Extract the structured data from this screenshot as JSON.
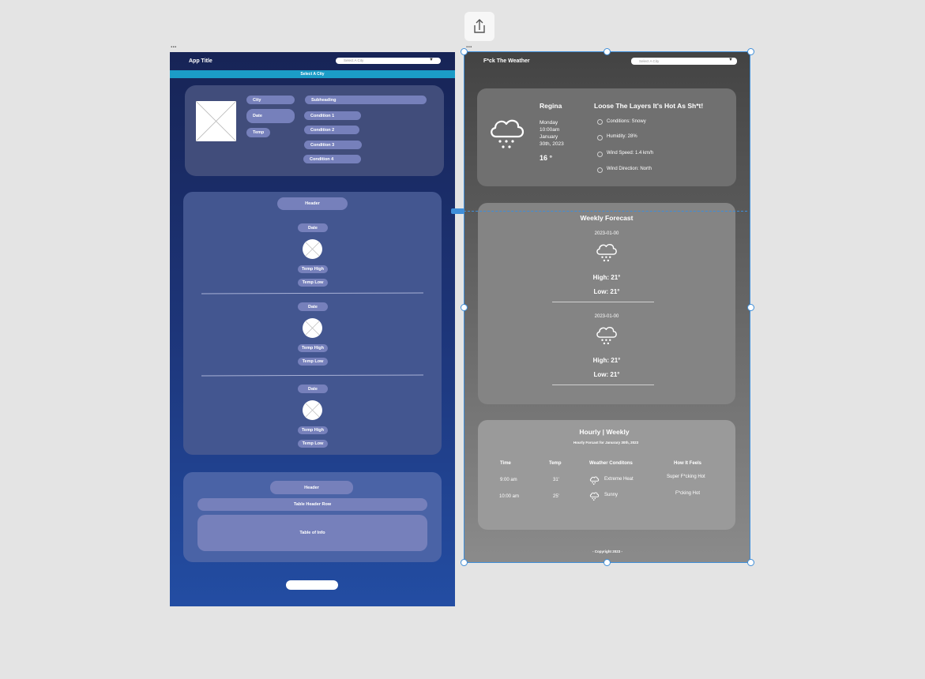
{
  "toolbar": {
    "share_icon": "share-icon"
  },
  "frame_labels": {
    "left": "...",
    "right": "..."
  },
  "wireframe": {
    "app_title": "App Title",
    "city_select_placeholder": "Select A City",
    "city_banner": "Select A City",
    "current": {
      "labels": {
        "city": "City",
        "date": "Date",
        "temp": "Temp",
        "subheading": "Subheading"
      },
      "conditions": [
        "Condition 1",
        "Condition 2",
        "Condition 3",
        "Condition 4"
      ]
    },
    "forecast": {
      "header": "Header",
      "days": [
        {
          "date": "Date",
          "high": "Temp High",
          "low": "Temp Low"
        },
        {
          "date": "Date",
          "high": "Temp High",
          "low": "Temp Low"
        },
        {
          "date": "Date",
          "high": "Temp High",
          "low": "Temp Low"
        }
      ]
    },
    "table": {
      "header": "Header",
      "header_row": "Table Header Row",
      "body": "Table of Info"
    }
  },
  "mockup": {
    "app_title": "F*ck The Weather",
    "city_select_placeholder": "Select A City",
    "current": {
      "city": "Regina",
      "day": "Monday",
      "time": "10:00am",
      "month": "January",
      "date": "30th, 2023",
      "temp": "16 °",
      "headline": "Loose The Layers It's Hot As Sh*t!",
      "conditions": [
        "Conditions: Snowy",
        "Humidity: 28%",
        "Wind Speed: 1.4 km/h",
        "Wind Direction: North"
      ]
    },
    "weekly": {
      "title": "Weekly Forecast",
      "days": [
        {
          "date": "2023-01-00",
          "high": "High: 21°",
          "low": "Low: 21°"
        },
        {
          "date": "2023-01-00",
          "high": "High: 21°",
          "low": "Low: 21°"
        }
      ]
    },
    "hourly": {
      "title": "Hourly | Weekly",
      "subtitle": "Hourly Forcast for Janurary 30th, 2023",
      "columns": [
        "Time",
        "Temp",
        "Weather Conditons",
        "How It Feels"
      ],
      "rows": [
        {
          "time": "9:00 am",
          "temp": "31'",
          "conditions": "Extreme Heat",
          "feels": "Super F*cking Hot"
        },
        {
          "time": "10:00 am",
          "temp": "25'",
          "conditions": "Sunny",
          "feels": "F*cking Hot"
        }
      ]
    },
    "copyright": "- Copyright 2023 -"
  }
}
